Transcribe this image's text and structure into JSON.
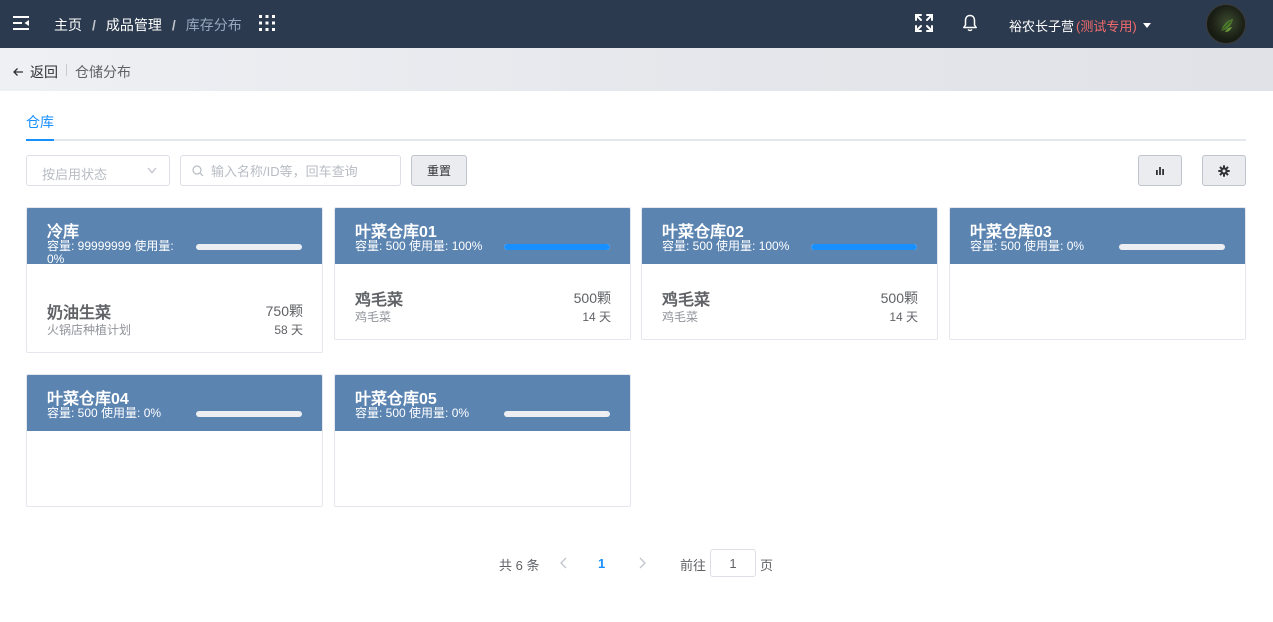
{
  "navbar": {
    "breadcrumb": [
      "主页",
      "成品管理",
      "库存分布"
    ],
    "user_name": "裕农长子营",
    "user_tag": "(测试专用)"
  },
  "subheader": {
    "back_label": "返回",
    "title": "仓储分布"
  },
  "tabs": [
    {
      "label": "仓库",
      "active": true
    }
  ],
  "filters": {
    "status_placeholder": "按启用状态",
    "search_placeholder": "输入名称/ID等，回车查询",
    "reset_label": "重置"
  },
  "warehouses": [
    {
      "name": "冷库",
      "meta": "容量: 99999999  使用量: 0%",
      "usage_fraction": 0.0,
      "items": [
        {
          "name": "奶油生菜",
          "plan": "火锅店种植计划",
          "qty": "750颗",
          "days": "58 天"
        }
      ]
    },
    {
      "name": "叶菜仓库01",
      "meta": "容量: 500  使用量: 100%",
      "usage_fraction": 1.0,
      "items": [
        {
          "name": "鸡毛菜",
          "plan": "鸡毛菜",
          "qty": "500颗",
          "days": "14 天"
        }
      ]
    },
    {
      "name": "叶菜仓库02",
      "meta": "容量: 500  使用量: 100%",
      "usage_fraction": 1.0,
      "items": [
        {
          "name": "鸡毛菜",
          "plan": "鸡毛菜",
          "qty": "500颗",
          "days": "14 天"
        }
      ]
    },
    {
      "name": "叶菜仓库03",
      "meta": "容量: 500  使用量: 0%",
      "usage_fraction": 0.0,
      "items": []
    },
    {
      "name": "叶菜仓库04",
      "meta": "容量: 500  使用量: 0%",
      "usage_fraction": 0.0,
      "items": []
    },
    {
      "name": "叶菜仓库05",
      "meta": "容量: 500  使用量: 0%",
      "usage_fraction": 0.0,
      "items": []
    }
  ],
  "pagination": {
    "total_label": "共 6 条",
    "current_page": "1",
    "goto_label": "前往",
    "goto_value": "1",
    "page_suffix": "页"
  },
  "colors": {
    "nav_bg": "#2b3a4e",
    "card_header": "#5b84b1",
    "accent": "#1890ff",
    "user_tag": "#f56c6c"
  },
  "icons": [
    "hamburger-icon",
    "grid-icon",
    "fullscreen-icon",
    "bell-icon",
    "caret-down-icon",
    "back-arrow-icon",
    "chevron-down-icon",
    "search-icon",
    "bar-chart-icon",
    "gear-icon",
    "chevron-left-icon",
    "chevron-right-icon"
  ]
}
